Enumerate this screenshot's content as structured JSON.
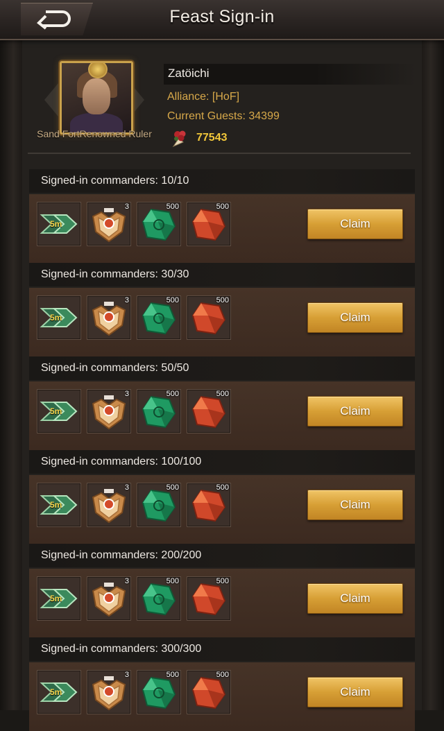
{
  "header": {
    "title": "Feast Sign-in",
    "back_icon": "back-arrow-icon"
  },
  "profile": {
    "name": "Zatöichi",
    "alliance": "Alliance: [HoF]",
    "current_guests": "Current Guests: 34399",
    "rank_title": "Sand FortRenowned Ruler",
    "flower_count": "77543",
    "flower_icon": "rose-bouquet-icon"
  },
  "tiers": [
    {
      "label": "Signed-in commanders: 10/10",
      "rewards": [
        {
          "icon": "speedup-5m-icon",
          "label": "5m",
          "qty": ""
        },
        {
          "icon": "medal-badge-icon",
          "label": "",
          "qty": "3"
        },
        {
          "icon": "green-gem-icon",
          "label": "",
          "qty": "500"
        },
        {
          "icon": "red-gem-icon",
          "label": "",
          "qty": "500"
        }
      ],
      "button": "Claim"
    },
    {
      "label": "Signed-in commanders: 30/30",
      "rewards": [
        {
          "icon": "speedup-5m-icon",
          "label": "5m",
          "qty": ""
        },
        {
          "icon": "medal-badge-icon",
          "label": "",
          "qty": "3"
        },
        {
          "icon": "green-gem-icon",
          "label": "",
          "qty": "500"
        },
        {
          "icon": "red-gem-icon",
          "label": "",
          "qty": "500"
        }
      ],
      "button": "Claim"
    },
    {
      "label": "Signed-in commanders: 50/50",
      "rewards": [
        {
          "icon": "speedup-5m-icon",
          "label": "5m",
          "qty": ""
        },
        {
          "icon": "medal-badge-icon",
          "label": "",
          "qty": "3"
        },
        {
          "icon": "green-gem-icon",
          "label": "",
          "qty": "500"
        },
        {
          "icon": "red-gem-icon",
          "label": "",
          "qty": "500"
        }
      ],
      "button": "Claim"
    },
    {
      "label": "Signed-in commanders: 100/100",
      "rewards": [
        {
          "icon": "speedup-5m-icon",
          "label": "5m",
          "qty": ""
        },
        {
          "icon": "medal-badge-icon",
          "label": "",
          "qty": "3"
        },
        {
          "icon": "green-gem-icon",
          "label": "",
          "qty": "500"
        },
        {
          "icon": "red-gem-icon",
          "label": "",
          "qty": "500"
        }
      ],
      "button": "Claim"
    },
    {
      "label": "Signed-in commanders: 200/200",
      "rewards": [
        {
          "icon": "speedup-5m-icon",
          "label": "5m",
          "qty": ""
        },
        {
          "icon": "medal-badge-icon",
          "label": "",
          "qty": "3"
        },
        {
          "icon": "green-gem-icon",
          "label": "",
          "qty": "500"
        },
        {
          "icon": "red-gem-icon",
          "label": "",
          "qty": "500"
        }
      ],
      "button": "Claim"
    },
    {
      "label": "Signed-in commanders: 300/300",
      "rewards": [
        {
          "icon": "speedup-5m-icon",
          "label": "5m",
          "qty": ""
        },
        {
          "icon": "medal-badge-icon",
          "label": "",
          "qty": "3"
        },
        {
          "icon": "green-gem-icon",
          "label": "",
          "qty": "500"
        },
        {
          "icon": "red-gem-icon",
          "label": "",
          "qty": "500"
        }
      ],
      "button": "Claim"
    }
  ],
  "colors": {
    "accent_gold": "#d79f35",
    "info_text": "#d8a94a",
    "flower_count": "#f2c73a"
  }
}
